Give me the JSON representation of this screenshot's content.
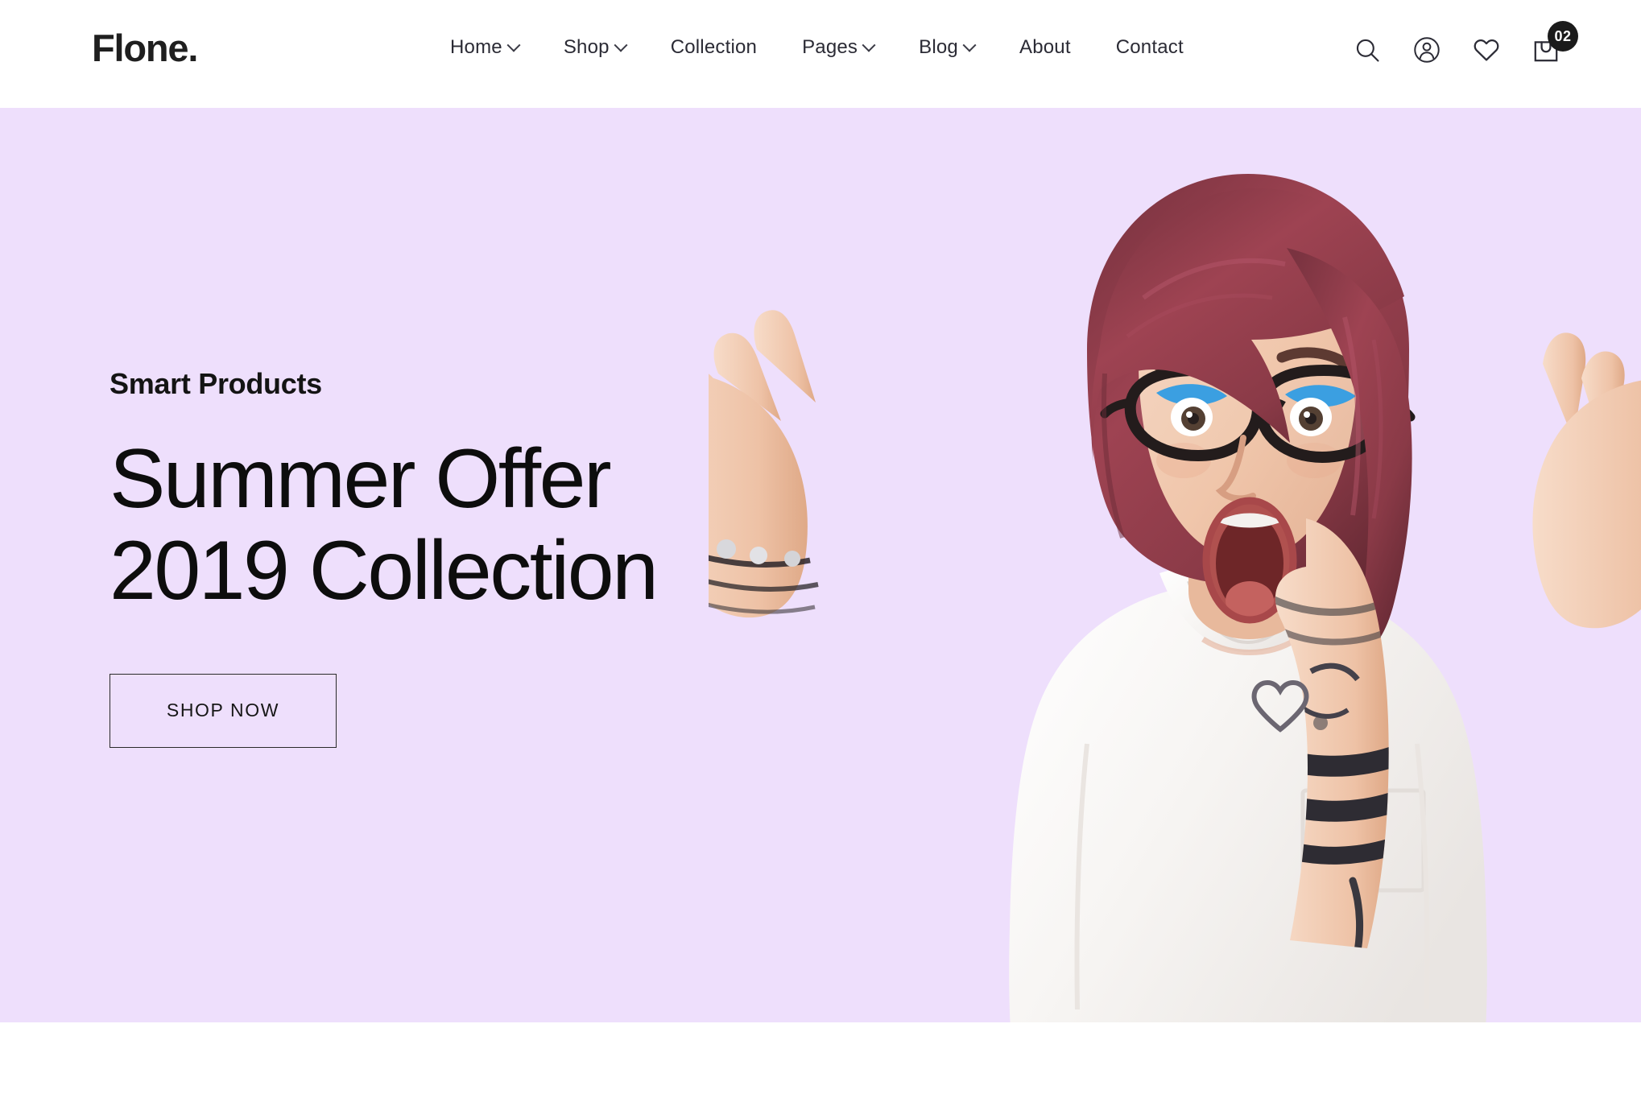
{
  "brand": {
    "logo": "Flone."
  },
  "nav": {
    "items": [
      {
        "label": "Home",
        "has_dropdown": true
      },
      {
        "label": "Shop",
        "has_dropdown": true
      },
      {
        "label": "Collection",
        "has_dropdown": false
      },
      {
        "label": "Pages",
        "has_dropdown": true
      },
      {
        "label": "Blog",
        "has_dropdown": true
      },
      {
        "label": "About",
        "has_dropdown": false
      },
      {
        "label": "Contact",
        "has_dropdown": false
      }
    ]
  },
  "header_icons": {
    "search": "search-icon",
    "account": "user-account-icon",
    "wishlist": "heart-icon",
    "cart": "shopping-bag-icon",
    "cart_count": "02"
  },
  "hero": {
    "eyebrow": "Smart Products",
    "headline_line1": "Summer Offer",
    "headline_line2": "2019 Collection",
    "cta_label": "SHOP NOW",
    "background_color": "#EEDFFC",
    "text_color": "#0d0d0d",
    "image_alt": "surprised-woman-with-glasses"
  }
}
